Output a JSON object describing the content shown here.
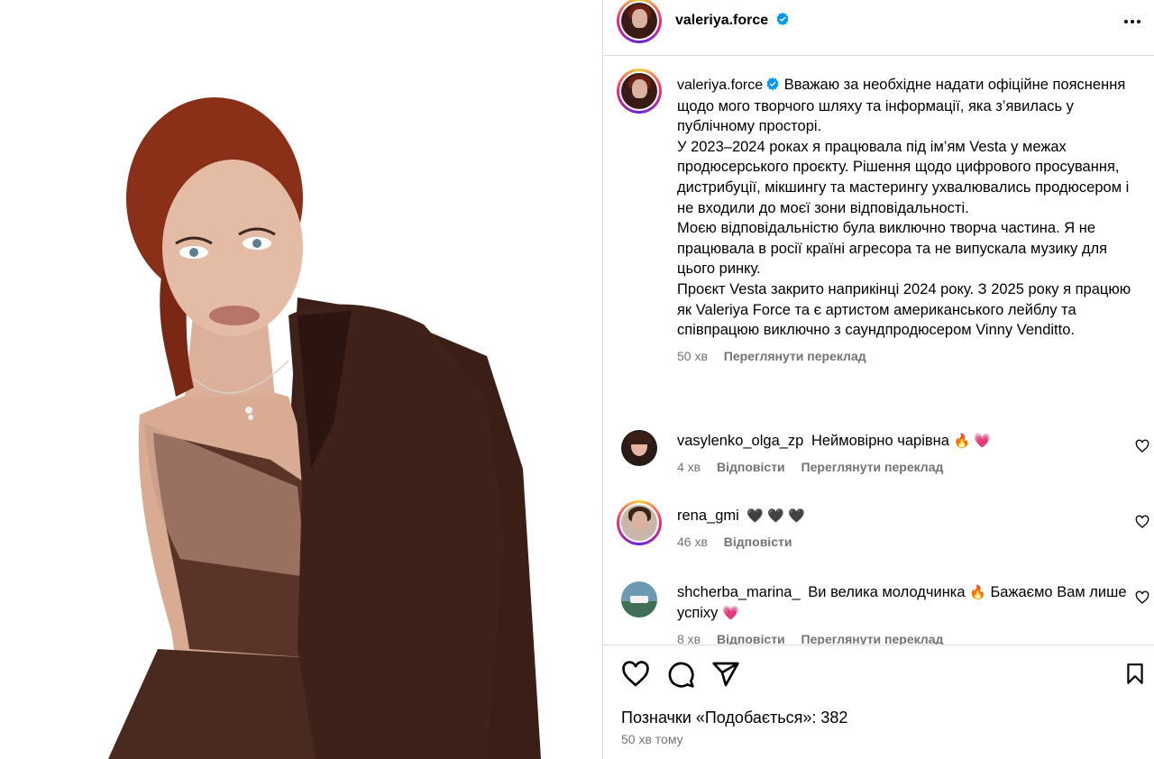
{
  "post": {
    "author": "valeriya.force",
    "caption_lines": [
      "Вважаю за необхідне надати офіційне пояснення щодо мого творчого шляху та інформації, яка з’явилась у публічному просторі.",
      "У 2023–2024 роках я працювала під ім’ям Vesta у межах продюсерського проєкту. Рішення щодо цифрового просування, дистрибуції, мікшингу та мастерингу ухвалювались продюсером і не входили до моєї зони відповідальності.",
      "Моєю відповідальністю була виключно творча частина. Я не працювала в росії країні агресора та не випускала музику для цього ринку.",
      "Проєкт Vesta закрито наприкінці 2024 року. З 2025 року я працюю як Valeriya Force та є артистом американського лейблу та співпрацюю виключно з саундпродюсером Vinny Venditto."
    ],
    "caption_time": "50 хв",
    "see_translation": "Переглянути переклад",
    "likes_text": "Позначки «Подобається»: 382",
    "time_ago": "50 хв тому"
  },
  "comments": [
    {
      "user": "vasylenko_olga_zp",
      "text": "Неймовірно чарівна",
      "emoji": "🔥 💗",
      "time": "4 хв",
      "reply": "Відповісти",
      "translate": "Переглянути переклад"
    },
    {
      "user": "rena_gmi",
      "text": "",
      "emoji": "🖤 🖤 🖤",
      "time": "46 хв",
      "reply": "Відповісти",
      "translate": ""
    },
    {
      "user": "shcherba_marina_",
      "text": "Ви велика молодчинка",
      "emoji": "🔥",
      "text2": "Бажаємо Вам лише успіху",
      "emoji2": "💗",
      "time": "8 хв",
      "reply": "Відповісти",
      "translate": "Переглянути переклад"
    }
  ],
  "icons": {
    "more": "more-horizontal-icon",
    "verified": "verified-badge-icon",
    "like": "heart-icon",
    "comment": "comment-icon",
    "share": "share-icon",
    "save": "bookmark-icon"
  },
  "colors": {
    "verified_blue": "#0095f6",
    "muted": "#737373",
    "border": "#dbdbdb"
  }
}
